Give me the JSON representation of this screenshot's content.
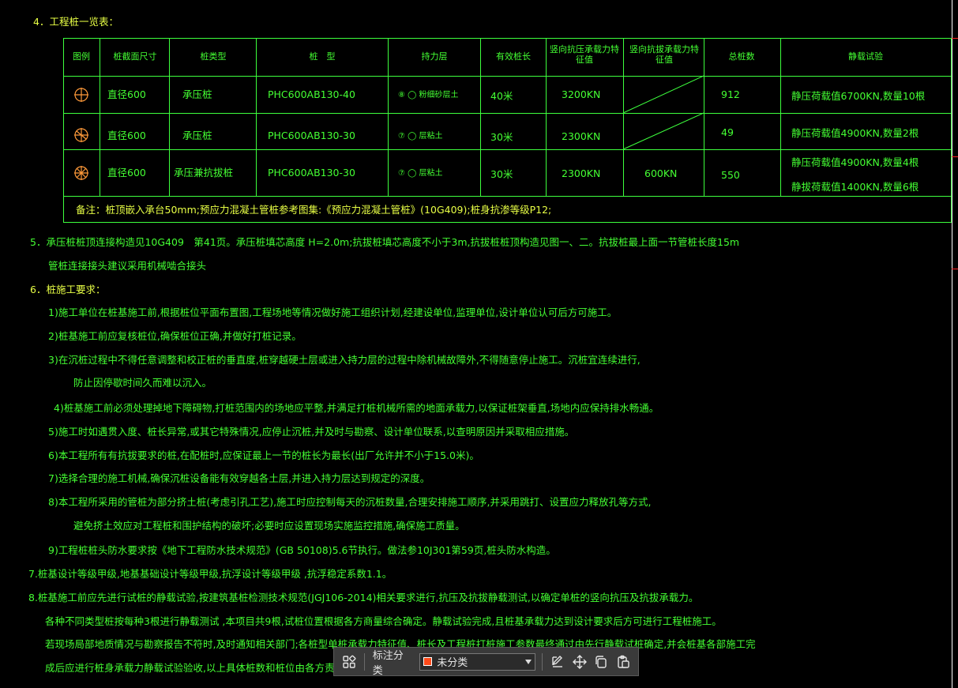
{
  "lines": [
    {
      "id": "l4",
      "text": "4．工程桩一览表："
    },
    {
      "id": "l5a",
      "text": "5．承压桩桩顶连接构造见10G409　第41页。承压桩填芯高度 H=2.0m;抗拔桩填芯高度不小于3m,抗拔桩桩顶构造见图一、二。抗拔桩最上面一节管桩长度15m"
    },
    {
      "id": "l5b",
      "text": "管桩连接接头建议采用机械啮合接头"
    },
    {
      "id": "l6",
      "text": "6．桩施工要求："
    },
    {
      "id": "l61",
      "text": "1)施工单位在桩基施工前,根据桩位平面布置图,工程场地等情况做好施工组织计划,经建设单位,监理单位,设计单位认可后方可施工。"
    },
    {
      "id": "l62",
      "text": "2)桩基施工前应复核桩位,确保桩位正确,并做好打桩记录。"
    },
    {
      "id": "l63a",
      "text": "3)在沉桩过程中不得任意调整和校正桩的垂直度,桩穿越硬土层或进入持力层的过程中除机械故障外,不得随意停止施工。沉桩宜连续进行,"
    },
    {
      "id": "l63b",
      "text": "防止因停歇时间久而难以沉入。"
    },
    {
      "id": "l64",
      "text": "4)桩基施工前必须处理掉地下障碍物,打桩范围内的场地应平整,并满足打桩机械所需的地面承载力,以保证桩架垂直,场地内应保持排水畅通。"
    },
    {
      "id": "l65",
      "text": "5)施工时如遇贯入度、桩长异常,或其它特殊情况,应停止沉桩,并及时与勘察、设计单位联系,以查明原因并采取相应措施。"
    },
    {
      "id": "l66",
      "text": "6)本工程所有有抗拔要求的桩,在配桩时,应保证最上一节的桩长为最长(出厂允许并不小于15.0米)。"
    },
    {
      "id": "l67",
      "text": "7)选择合理的施工机械,确保沉桩设备能有效穿越各土层,并进入持力层达到规定的深度。"
    },
    {
      "id": "l68a",
      "text": "8)本工程所采用的管桩为部分挤土桩(考虑引孔工艺),施工时应控制每天的沉桩数量,合理安排施工顺序,并采用跳打、设置应力释放孔等方式,"
    },
    {
      "id": "l68b",
      "text": "避免挤土效应对工程桩和围护结构的破坏;必要时应设置现场实施监控措施,确保施工质量。"
    },
    {
      "id": "l69",
      "text": "9)工程桩桩头防水要求按《地下工程防水技术规范》(GB 50108)5.6节执行。做法参10J301第59页,桩头防水构造。"
    },
    {
      "id": "l7",
      "text": "7.桩基设计等级甲级,地基基础设计等级甲级,抗浮设计等级甲级 ,抗浮稳定系数1.1。"
    },
    {
      "id": "l8",
      "text": "8.桩基施工前应先进行试桩的静载试验,按建筑基桩检测技术规范(JGJ106-2014)相关要求进行,抗压及抗拔静载测试,以确定单桩的竖向抗压及抗拔承载力。"
    },
    {
      "id": "l8b",
      "text": "各种不同类型桩按每种3根进行静载测试 ,本项目共9根,试桩位置根据各方商量综合确定。静载试验完成,且桩基承载力达到设计要求后方可进行工程桩施工。"
    },
    {
      "id": "l8c",
      "text": "若现场局部地质情况与勘察报告不符时,及时通知相关部门;各桩型单桩承载力特征值、桩长及工程桩打桩施工参数最终通过由先行静载试桩确定,并会桩基各部施工完"
    },
    {
      "id": "l8d",
      "text": "成后应进行桩身承载力静载试验验收,以上具体桩数和桩位由各方责任主体在现场确认。"
    }
  ],
  "table": {
    "headers": [
      "图例",
      "桩截面尺寸",
      "桩类型",
      "桩　型",
      "持力层",
      "有效桩长",
      "竖向抗压承载力特征值",
      "竖向抗拔承载力特征值",
      "总桩数",
      "静载试验"
    ],
    "rows": [
      {
        "size": "直径600",
        "type": "承压桩",
        "model": "PHC600AB130-40",
        "layer": "⑧ ◯ 粉细砂层土",
        "length": "40米",
        "compress": "3200KN",
        "pull": "",
        "count": "912",
        "test1": "静压荷载值6700KN,数量10根",
        "test2": ""
      },
      {
        "size": "直径600",
        "type": "承压桩",
        "model": "PHC600AB130-30",
        "layer": "⑦ ◯ 层粘土",
        "length": "30米",
        "compress": "2300KN",
        "pull": "",
        "count": "49",
        "test1": "静压荷载值4900KN,数量2根",
        "test2": ""
      },
      {
        "size": "直径600",
        "type": "承压兼抗拔桩",
        "model": "PHC600AB130-30",
        "layer": "⑦ ◯ 层粘土",
        "length": "30米",
        "compress": "2300KN",
        "pull": "600KN",
        "count": "550",
        "test1": "静压荷载值4900KN,数量4根",
        "test2": "静拔荷载值1400KN,数量6根"
      }
    ],
    "note": "备注：桩顶嵌入承台50mm;预应力混凝土管桩参考图集:《预应力混凝土管桩》(10G409);桩身抗渗等级P12;"
  },
  "toolbar": {
    "grid_icon": "apps-grid-icon",
    "label": "标注分类",
    "selected": "未分类",
    "swatch_color": "#ff4a1a",
    "icons": [
      "edit-icon",
      "move-icon",
      "copy-icon",
      "paste-icon"
    ]
  },
  "colors": {
    "background": "#000000",
    "text": "#44ff33",
    "header": "#e8ff45",
    "table_lines": "#3dff3d",
    "frame": "#ffffff"
  }
}
